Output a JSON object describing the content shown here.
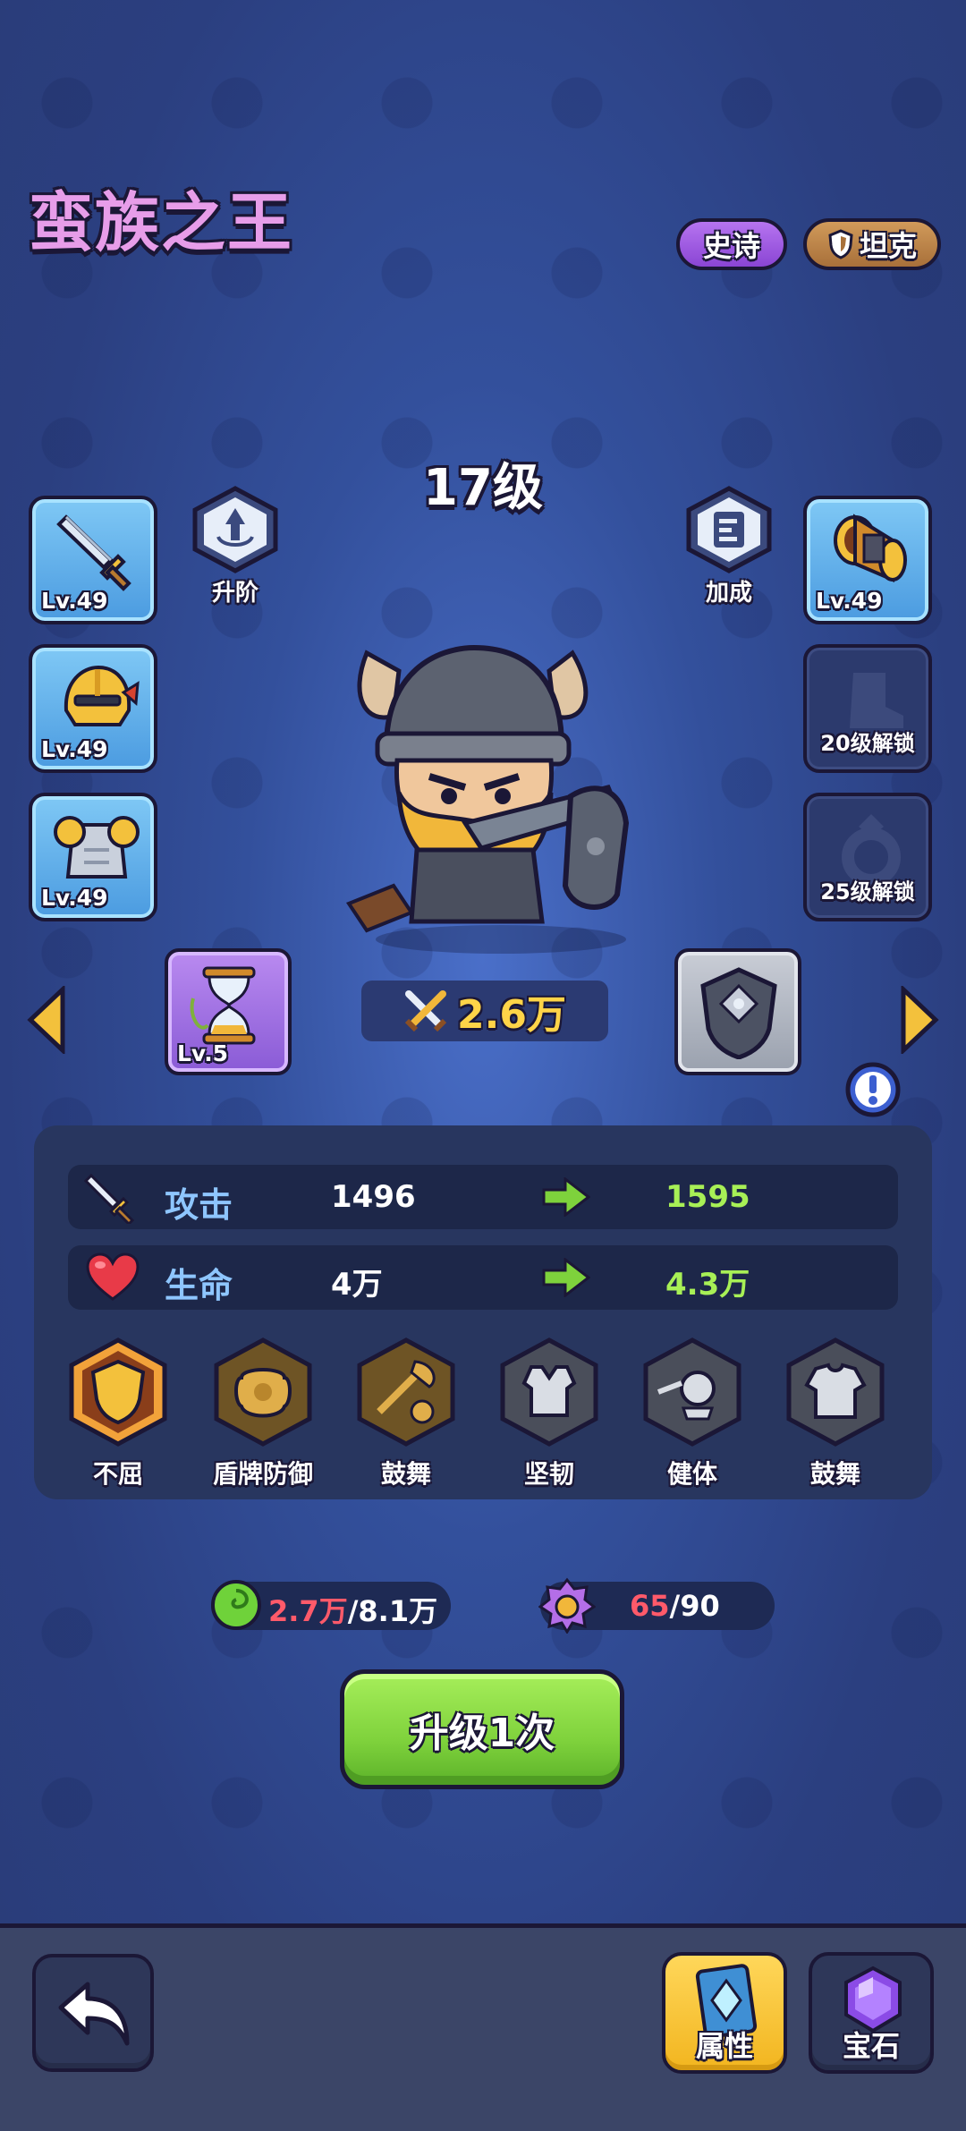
{
  "hero": {
    "name": "蛮族之王",
    "rarity": "史诗",
    "class": "坦克",
    "level_label": "17级",
    "power": "2.6万"
  },
  "actions": {
    "ascend_label": "升阶",
    "bonus_label": "加成"
  },
  "equipment_left": [
    {
      "icon": "sword-icon",
      "level": "Lv.49"
    },
    {
      "icon": "helmet-icon",
      "level": "Lv.49"
    },
    {
      "icon": "armor-icon",
      "level": "Lv.49"
    }
  ],
  "equipment_right": [
    {
      "icon": "bracer-icon",
      "level": "Lv.49"
    },
    {
      "icon": "boots-icon",
      "lock_text": "20级解锁"
    },
    {
      "icon": "ring-icon",
      "lock_text": "25级解锁"
    }
  ],
  "artifact": {
    "icon": "hourglass-icon",
    "level": "Lv.5"
  },
  "shield_item": {
    "icon": "shield-icon"
  },
  "stats": [
    {
      "icon": "sword-icon",
      "name": "攻击",
      "current": "1496",
      "next": "1595"
    },
    {
      "icon": "heart-icon",
      "name": "生命",
      "current": "4万",
      "next": "4.3万"
    }
  ],
  "talents": [
    {
      "icon": "shield-talent-icon",
      "label": "不屈",
      "active": true
    },
    {
      "icon": "shield-defense-icon",
      "label": "盾牌防御",
      "active": true
    },
    {
      "icon": "skull-axe-icon",
      "label": "鼓舞",
      "active": true
    },
    {
      "icon": "vest-icon",
      "label": "坚韧",
      "active": false
    },
    {
      "icon": "fitness-icon",
      "label": "健体",
      "active": false
    },
    {
      "icon": "shirt-icon",
      "label": "鼓舞",
      "active": false
    }
  ],
  "resources": {
    "exp_have": "2.7万",
    "exp_need": "/8.1万",
    "shard_have": "65",
    "shard_need": "/90"
  },
  "upgrade": {
    "label": "升级1次"
  },
  "bottom_tabs": {
    "attributes": "属性",
    "gems": "宝石"
  },
  "colors": {
    "accent_green": "#a8f056",
    "deficit_red": "#ff5a6a",
    "power_gold": "#ffd448",
    "name_purple": "#e79de9"
  }
}
